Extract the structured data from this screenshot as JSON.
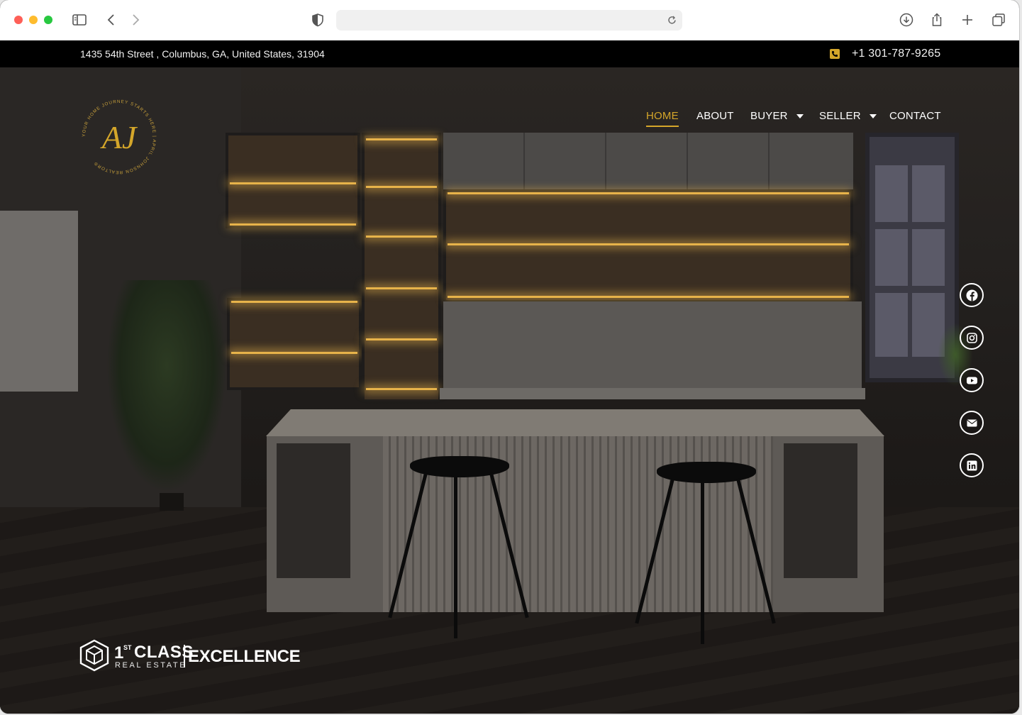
{
  "browser": {
    "url_value": "",
    "icons": {
      "sidebar": "sidebar-icon",
      "back": "chevron-left-icon",
      "forward": "chevron-right-icon",
      "privacy": "shield-icon",
      "reload": "reload-icon",
      "download": "download-icon",
      "share": "share-icon",
      "new_tab": "plus-icon",
      "tabs": "tabs-icon"
    }
  },
  "topbar": {
    "address": "1435 54th Street , Columbus, GA, United States, 31904",
    "phone": "+1 301-787-9265"
  },
  "logo": {
    "monogram": "AJ",
    "ring_text": "YOUR HOME JOURNEY STARTS HERE | APRIL JOHNSON REALTOR®"
  },
  "nav": {
    "items": [
      {
        "label": "HOME",
        "active": true
      },
      {
        "label": "ABOUT"
      },
      {
        "label": "BUYER",
        "has_dropdown": true
      },
      {
        "label": "SELLER",
        "has_dropdown": true
      },
      {
        "label": "CONTACT"
      }
    ]
  },
  "social": [
    "facebook-icon",
    "instagram-icon",
    "youtube-icon",
    "email-icon",
    "linkedin-icon"
  ],
  "brokerage": {
    "one": "1",
    "superscript": "ST",
    "class_word": "CLASS",
    "real_estate": "REAL ESTATE",
    "excellence": "EXCELLENCE"
  },
  "colors": {
    "accent_gold": "#d4a62a",
    "topbar_bg": "#000000",
    "nav_text": "#ffffff"
  }
}
